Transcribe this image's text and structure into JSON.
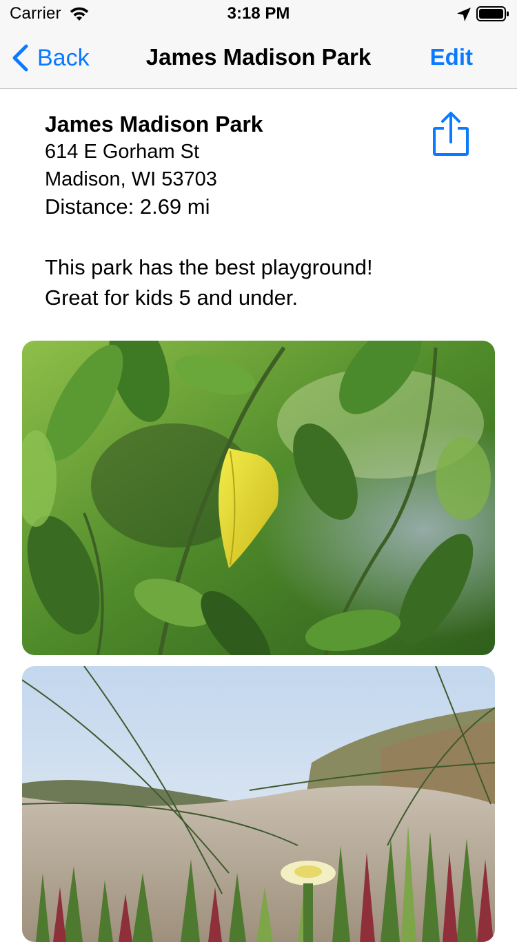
{
  "status_bar": {
    "carrier": "Carrier",
    "time": "3:18 PM",
    "icons": [
      "wifi-icon",
      "location-arrow-icon",
      "battery-icon"
    ]
  },
  "nav_bar": {
    "back_label": "Back",
    "title": "James Madison Park",
    "edit_label": "Edit",
    "accent_color": "#0a7aff"
  },
  "park": {
    "name": "James Madison Park",
    "address_line1": "614 E Gorham St",
    "address_line2": "Madison, WI  53703",
    "distance": "Distance: 2.69 mi",
    "description_line1": "This park has the best playground!",
    "description_line2": "Great for kids 5 and under.",
    "share_icon": "share-icon"
  },
  "photos": [
    {
      "subject": "green leaves with a yellow leaf"
    },
    {
      "subject": "beach dune grass with a pale yellow flower"
    }
  ]
}
